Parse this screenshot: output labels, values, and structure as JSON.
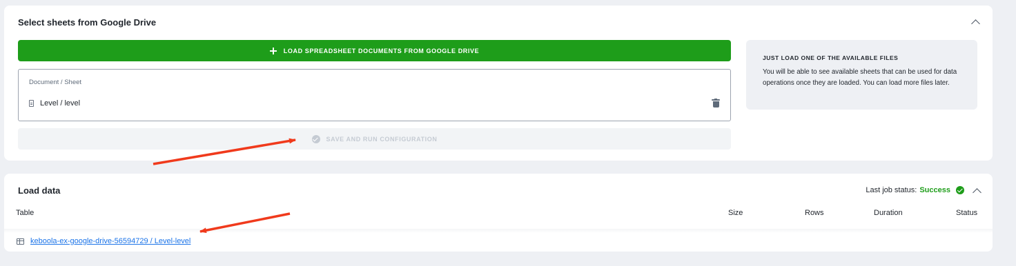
{
  "select_section": {
    "title": "Select sheets from Google Drive",
    "load_button_label": "LOAD SPREADSHEET DOCUMENTS FROM GOOGLE DRIVE",
    "document_label": "Document / Sheet",
    "document_value": "Level / level",
    "save_button_label": "SAVE AND RUN CONFIGURATION",
    "info_title": "JUST LOAD ONE OF THE AVAILABLE FILES",
    "info_body": "You will be able to see available sheets that can be used for data operations once they are loaded. You can load more files later."
  },
  "load_section": {
    "title": "Load data",
    "status_label": "Last job status:",
    "status_value": "Success",
    "columns": [
      "Table",
      "Size",
      "Rows",
      "Duration",
      "Status"
    ],
    "rows": [
      {
        "table": "keboola-ex-google-drive-56594729 / Level-level"
      }
    ]
  },
  "colors": {
    "accent_green": "#1e9d1a",
    "link_blue": "#1a73e8",
    "annotation_red": "#f03a1c"
  },
  "icons": [
    "plus-icon",
    "file-icon",
    "trash-icon",
    "check-circle-icon",
    "chevron-up-icon",
    "table-icon",
    "arrow-annotation"
  ]
}
